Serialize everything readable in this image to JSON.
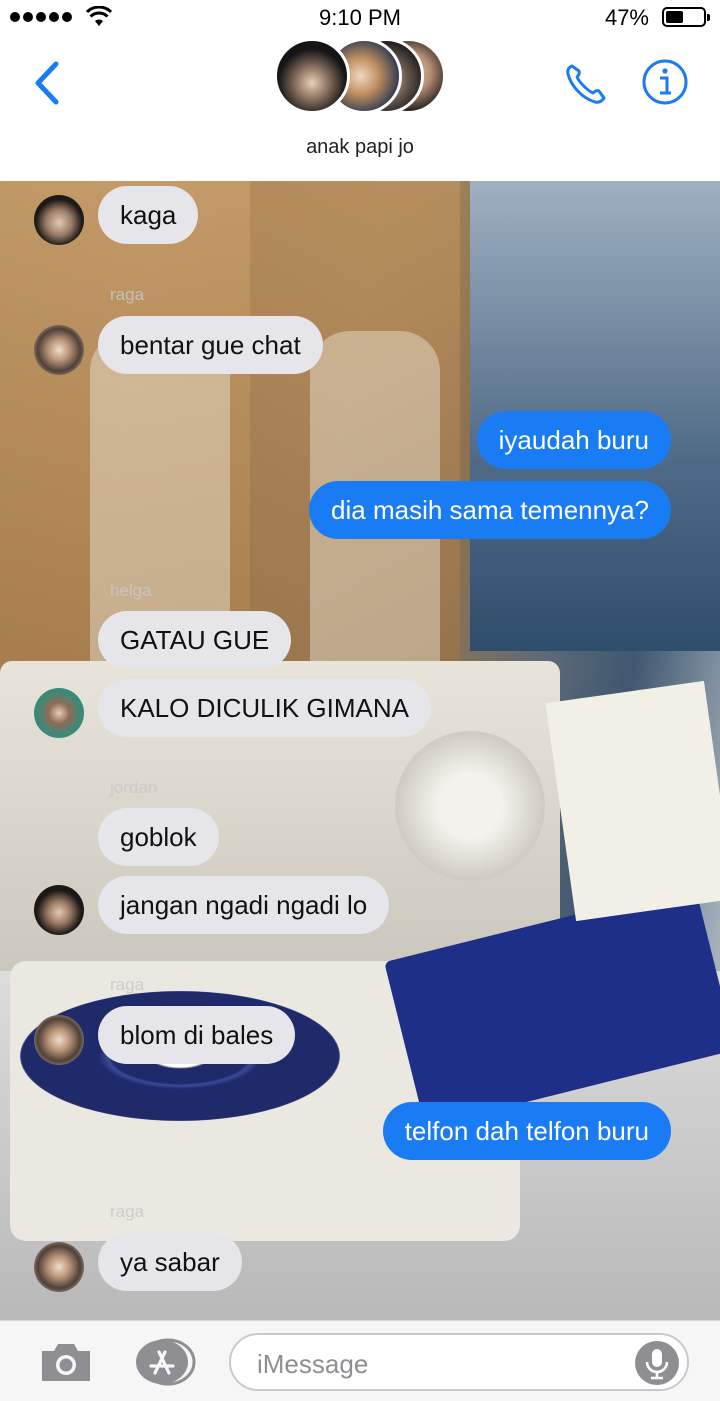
{
  "status_bar": {
    "time": "9:10 PM",
    "battery_percent": "47%",
    "battery_level": 0.47,
    "signal_bars": 5
  },
  "header": {
    "group_name": "anak papi jo",
    "back_icon": "chevron-left-icon",
    "call_icon": "phone-icon",
    "info_icon": "info-icon",
    "accent_color": "#1a7cf5"
  },
  "messages": [
    {
      "direction": "in",
      "text": "kaga"
    },
    {
      "direction": "in",
      "sender": "raga",
      "text": "bentar gue chat"
    },
    {
      "direction": "out",
      "text": "iyaudah buru"
    },
    {
      "direction": "out",
      "text": "dia masih sama temennya?"
    },
    {
      "direction": "in",
      "sender": "helga",
      "text": "GATAU GUE"
    },
    {
      "direction": "in",
      "text": "KALO DICULIK GIMANA"
    },
    {
      "direction": "in",
      "sender": "jordan",
      "text": "goblok"
    },
    {
      "direction": "in",
      "text": "jangan ngadi ngadi lo"
    },
    {
      "direction": "in",
      "sender": "raga",
      "text": "blom di bales"
    },
    {
      "direction": "out",
      "text": "telfon dah telfon buru"
    },
    {
      "direction": "in",
      "sender": "raga",
      "text": "ya sabar"
    }
  ],
  "input_bar": {
    "placeholder": "iMessage",
    "camera_icon": "camera-icon",
    "apps_icon": "app-store-icon",
    "mic_icon": "microphone-icon"
  },
  "colors": {
    "incoming_bubble": "#e5e5ea",
    "outgoing_bubble": "#1a7cf5"
  }
}
